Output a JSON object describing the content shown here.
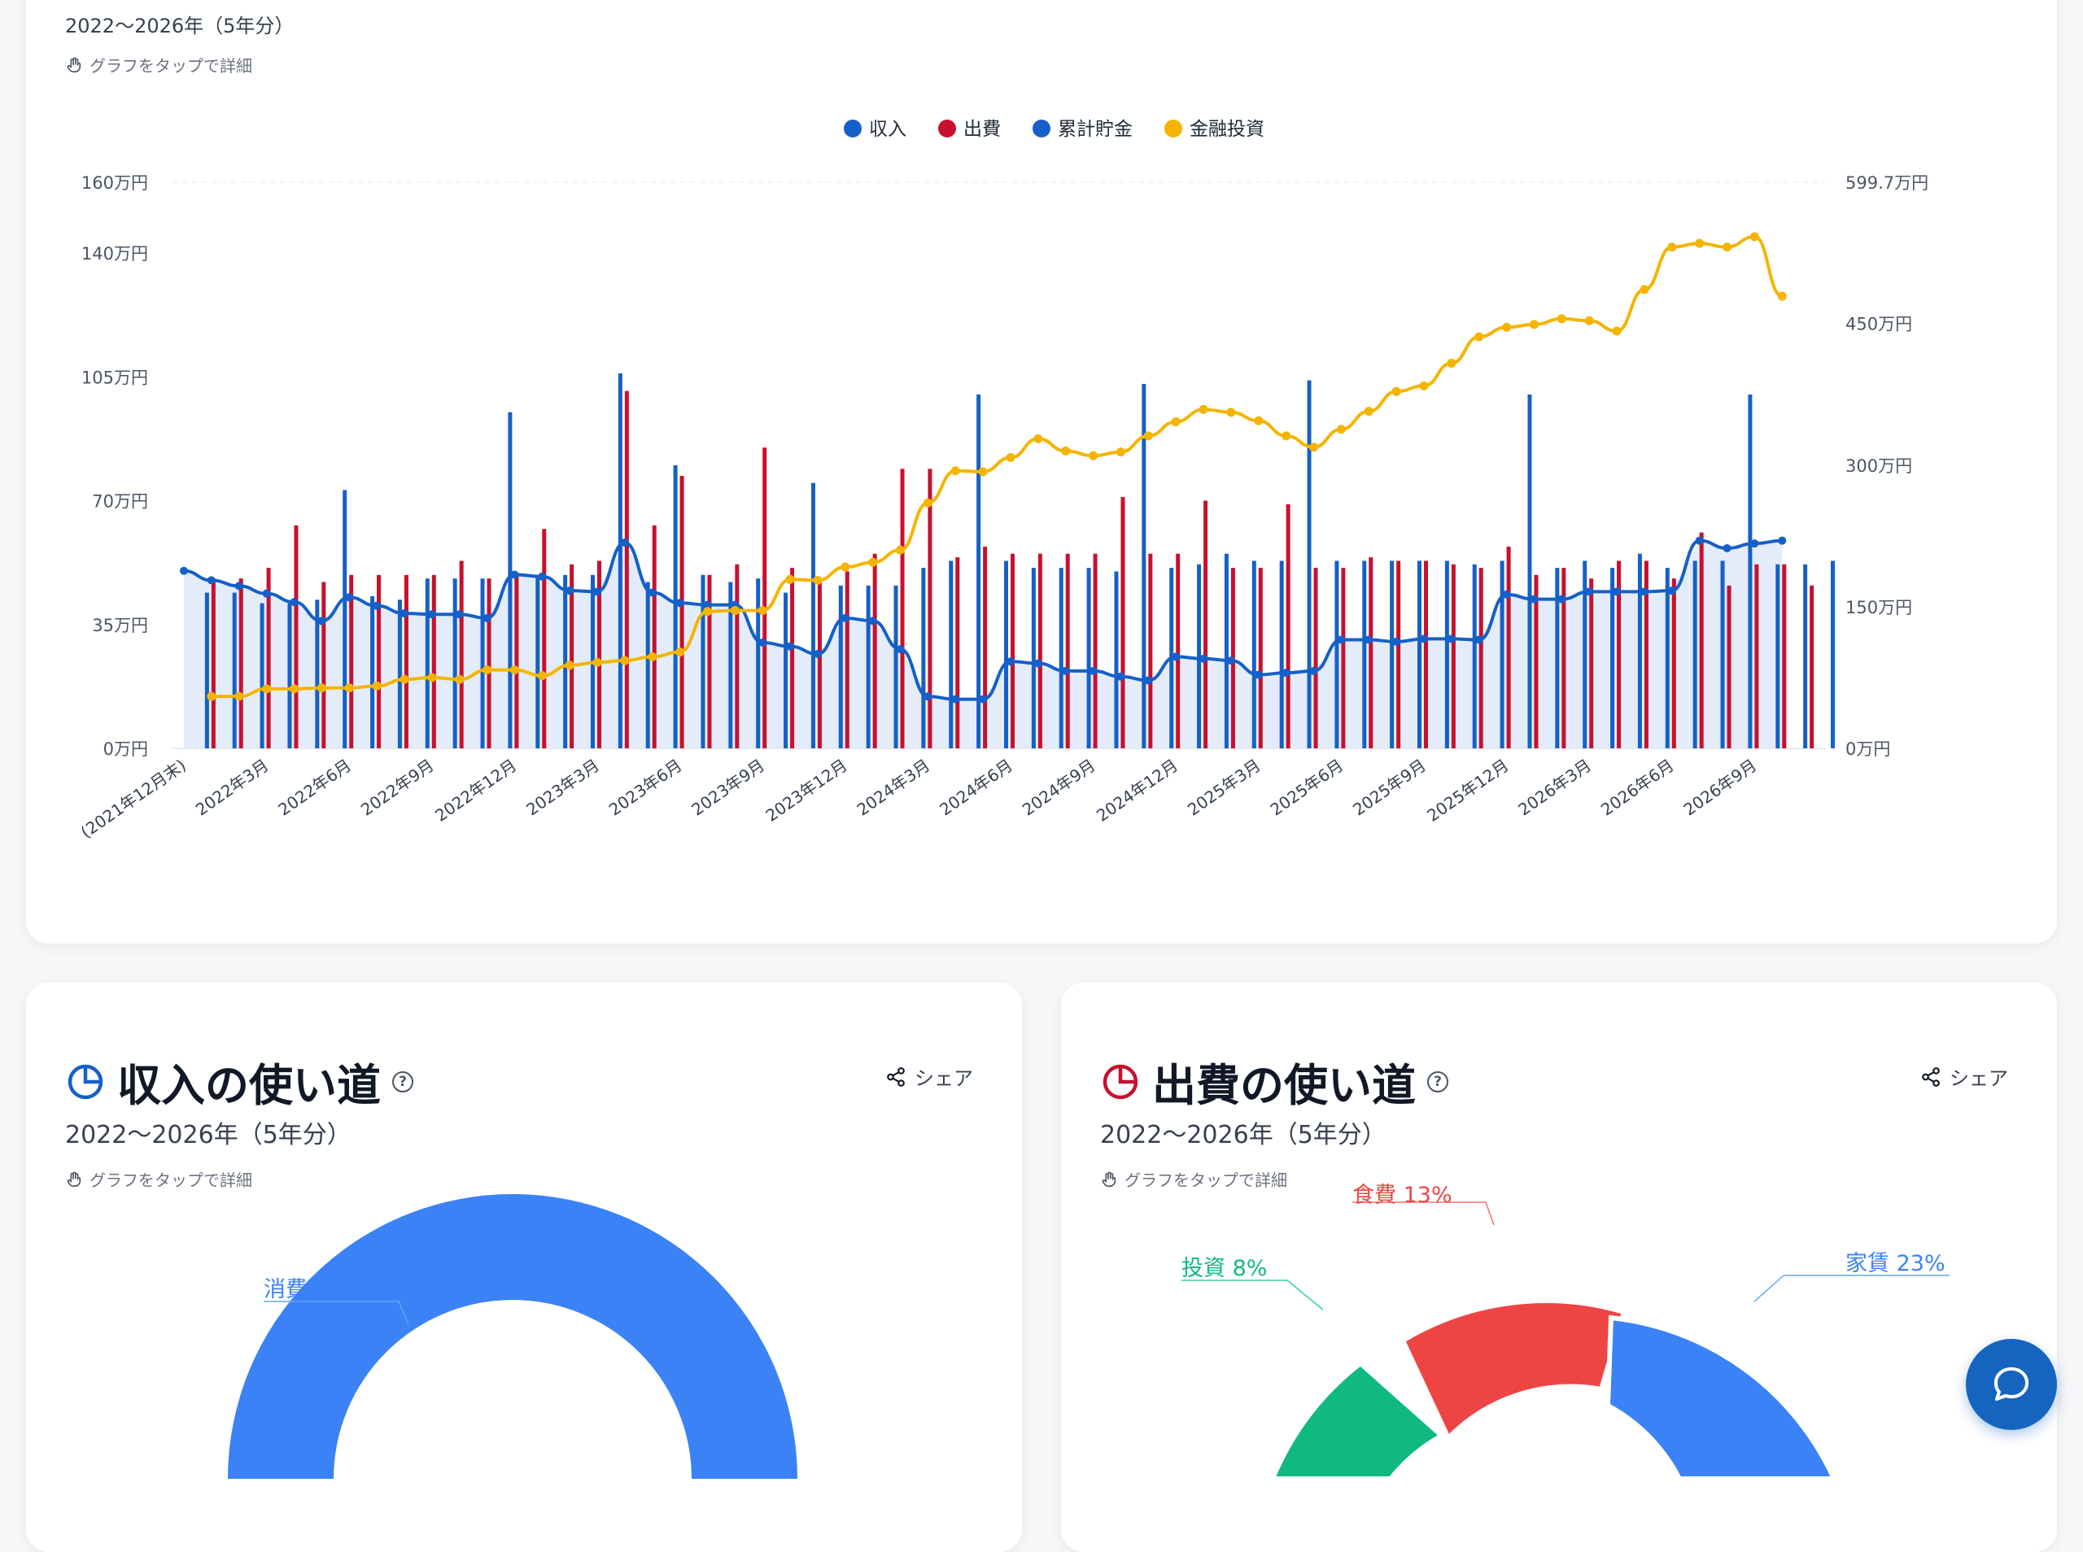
{
  "top_card": {
    "subtitle": "2022〜2026年（5年分）",
    "hint": "グラフをタップで詳細"
  },
  "colors": {
    "income": "#1560c8",
    "expense": "#c8102e",
    "savings": "#1560c8",
    "investment": "#f5b400",
    "area_fill": "#dbe5f7",
    "consumption": "#3b82f6",
    "food": "#ef4444",
    "rent": "#3b82f6",
    "invest_slice": "#10b981"
  },
  "chart_data": [
    {
      "type": "bar",
      "legend": [
        "収入",
        "出費",
        "累計貯金",
        "金融投資"
      ],
      "legend_placement": "top-center",
      "y_left_ticks": [
        "0万円",
        "35万円",
        "70万円",
        "105万円",
        "140万円",
        "160万円"
      ],
      "y_left_tick_values": [
        0,
        35,
        70,
        105,
        140,
        160
      ],
      "y_right_ticks": [
        "0万円",
        "150万円",
        "300万円",
        "450万円",
        "599.7万円"
      ],
      "y_right_tick_values": [
        0,
        150,
        300,
        450,
        599.7
      ],
      "ylim_left": [
        0,
        160
      ],
      "ylim_right": [
        0,
        599.7
      ],
      "x_ticks": [
        "(2021年12月末)",
        "2022年3月",
        "2022年6月",
        "2022年9月",
        "2022年12月",
        "2023年3月",
        "2023年6月",
        "2023年9月",
        "2023年12月",
        "2024年3月",
        "2024年6月",
        "2024年9月",
        "2024年12月",
        "2025年3月",
        "2025年6月",
        "2025年9月",
        "2025年12月",
        "2026年3月",
        "2026年6月",
        "2026年9月"
      ],
      "x_tick_index": [
        0,
        3,
        6,
        9,
        12,
        15,
        18,
        21,
        24,
        27,
        30,
        33,
        36,
        39,
        42,
        45,
        48,
        51,
        54,
        57
      ],
      "series": [
        {
          "name": "収入",
          "axis": "left",
          "start_index": 1,
          "values": [
            44,
            44,
            41,
            41,
            42,
            73,
            43,
            42,
            48,
            48,
            48,
            95,
            49,
            49,
            49,
            106,
            47,
            80,
            49,
            47,
            48,
            44,
            75,
            46,
            46,
            46,
            51,
            53,
            100,
            53,
            51,
            51,
            51,
            50,
            103,
            51,
            52,
            55,
            53,
            53,
            104,
            53,
            53,
            53,
            53,
            53,
            52,
            53,
            100,
            51,
            53,
            51,
            55,
            51,
            53,
            53,
            100,
            52,
            52,
            53
          ],
          "partial": false
        },
        {
          "name": "出費",
          "axis": "left",
          "start_index": 1,
          "values": [
            48,
            48,
            51,
            63,
            47,
            49,
            49,
            49,
            49,
            53,
            48,
            49,
            62,
            52,
            53,
            101,
            63,
            77,
            49,
            52,
            85,
            51,
            47,
            50,
            55,
            79,
            79,
            54,
            57,
            55,
            55,
            55,
            55,
            71,
            55,
            55,
            70,
            51,
            51,
            69,
            51,
            51,
            54,
            53,
            53,
            52,
            51,
            57,
            49,
            51,
            48,
            53,
            53,
            48,
            61,
            46,
            52,
            52,
            46
          ],
          "partial": false
        },
        {
          "name": "累計貯金",
          "axis": "right",
          "type": "line",
          "area": true,
          "values": [
            188,
            178,
            172,
            164,
            155,
            135,
            160,
            151,
            143,
            142,
            142,
            138,
            184,
            182,
            167,
            166,
            218,
            165,
            154,
            152,
            152,
            112,
            108,
            100,
            138,
            135,
            105,
            55,
            52,
            52,
            92,
            90,
            82,
            82,
            76,
            72,
            97,
            95,
            93,
            78,
            80,
            82,
            115,
            115,
            113,
            116,
            116,
            115,
            163,
            158,
            158,
            166,
            166,
            166,
            167,
            220,
            212,
            217,
            220
          ]
        },
        {
          "name": "金融投資",
          "axis": "right",
          "type": "line",
          "values": [
            55,
            55,
            63,
            63,
            64,
            64,
            66,
            73,
            75,
            73,
            83,
            83,
            77,
            88,
            91,
            93,
            97,
            102,
            145,
            146,
            146,
            179,
            178,
            192,
            197,
            210,
            260,
            294,
            293,
            308,
            328,
            315,
            310,
            314,
            331,
            346,
            359,
            356,
            347,
            331,
            319,
            338,
            357,
            378,
            384,
            408,
            436,
            446,
            449,
            455,
            453,
            442,
            486,
            531,
            535,
            531,
            542,
            479
          ]
        }
      ]
    },
    {
      "type": "pie",
      "title": "収入の使い道",
      "subtitle": "2022〜2026年（5年分）",
      "visible_labels": [
        {
          "label": "消費",
          "percent": 62
        }
      ]
    },
    {
      "type": "pie",
      "title": "出費の使い道",
      "subtitle": "2022〜2026年（5年分）",
      "visible_labels": [
        {
          "label": "食費",
          "percent": 13
        },
        {
          "label": "家賃",
          "percent": 23
        },
        {
          "label": "投資",
          "percent": 8
        }
      ]
    }
  ],
  "income_card": {
    "title": "収入の使い道",
    "subtitle": "2022〜2026年（5年分）",
    "hint": "グラフをタップで詳細",
    "share_label": "シェア",
    "labels": {
      "consumption": "消費 62%"
    }
  },
  "expense_card": {
    "title": "出費の使い道",
    "subtitle": "2022〜2026年（5年分）",
    "hint": "グラフをタップで詳細",
    "share_label": "シェア",
    "labels": {
      "food": "食費 13%",
      "rent": "家賃 23%",
      "invest": "投資 8%"
    }
  },
  "icons": {
    "hand": "hand-tap-icon",
    "pie": "pie-chart-icon",
    "help": "help-icon",
    "share": "share-icon",
    "chat": "chat-bubble-icon"
  }
}
